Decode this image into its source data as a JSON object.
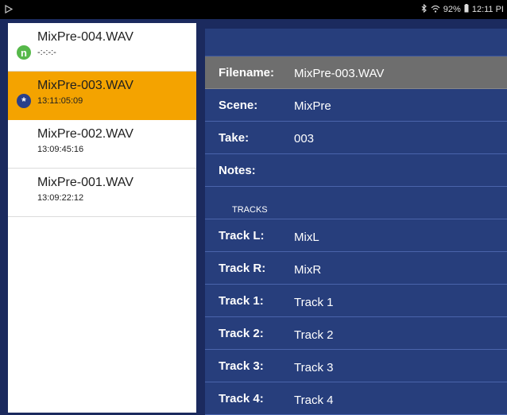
{
  "status_bar": {
    "app_icon": "play-store-icon",
    "bluetooth_icon": "bluetooth-icon",
    "wifi_icon": "wifi-icon",
    "battery_percent": "92%",
    "battery_icon": "battery-icon",
    "time": "12:11 PI"
  },
  "files": [
    {
      "name": "MixPre-004.WAV",
      "timecode": "-:-:-:-",
      "badge": "n",
      "badge_icon": "new-indicator-icon",
      "selected": false
    },
    {
      "name": "MixPre-003.WAV",
      "timecode": "13:11:05:09",
      "badge": "*",
      "badge_icon": "asterisk-icon",
      "selected": true
    },
    {
      "name": "MixPre-002.WAV",
      "timecode": "13:09:45:16",
      "selected": false
    },
    {
      "name": "MixPre-001.WAV",
      "timecode": "13:09:22:12",
      "selected": false
    }
  ],
  "detail": {
    "filename_label": "Filename:",
    "filename_value": "MixPre-003.WAV",
    "scene_label": "Scene:",
    "scene_value": "MixPre",
    "take_label": "Take:",
    "take_value": "003",
    "notes_label": "Notes:",
    "notes_value": "",
    "tracks_section": "TRACKS",
    "tracks": [
      {
        "label": "Track L:",
        "value": "MixL"
      },
      {
        "label": "Track R:",
        "value": "MixR"
      },
      {
        "label": "Track 1:",
        "value": "Track 1"
      },
      {
        "label": "Track 2:",
        "value": "Track 2"
      },
      {
        "label": "Track 3:",
        "value": "Track 3"
      },
      {
        "label": "Track 4:",
        "value": "Track 4"
      }
    ]
  },
  "colors": {
    "selected": "#f4a300",
    "panel": "#273e7c",
    "header_row": "#6e6e6e",
    "new_badge": "#56b84a"
  }
}
